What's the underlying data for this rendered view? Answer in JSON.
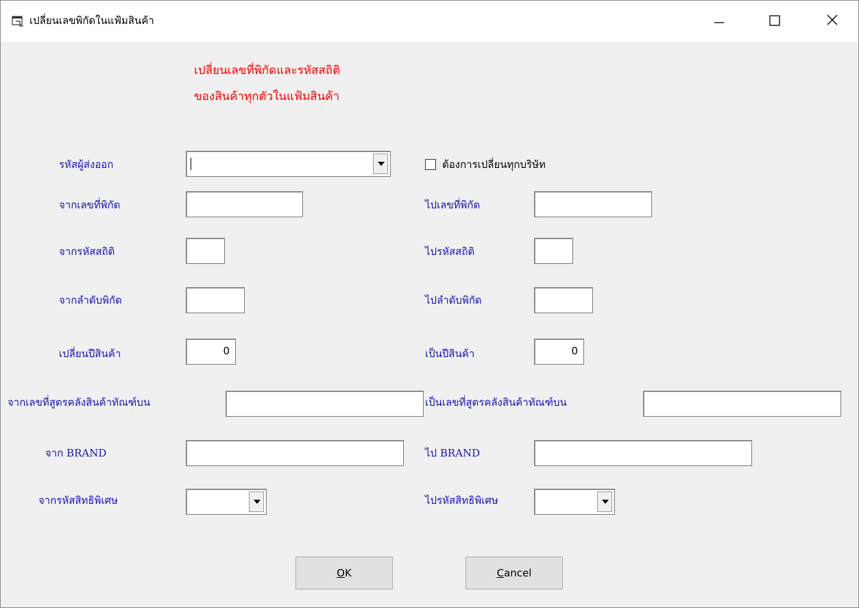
{
  "window": {
    "title": "เปลี่ยนเลขพิกัดในแฟ้มสินค้า",
    "minimize": "—",
    "maximize": "☐",
    "close": "✕"
  },
  "heading": {
    "line1": "เปลี่ยนเลขที่พิกัดและรหัสสถิติ",
    "line2": "ของสินค้าทุกตัวในแฟ้มสินค้า"
  },
  "form": {
    "exporter_code": {
      "label": "รหัสผู้ส่งออก",
      "value": ""
    },
    "all_companies": {
      "label": "ต้องการเปลี่ยนทุกบริษัท",
      "checked": false
    },
    "from_tariff_no": {
      "label": "จากเลขที่พิกัด",
      "value": ""
    },
    "to_tariff_no": {
      "label": "ไปเลขที่พิกัด",
      "value": ""
    },
    "from_stat_code": {
      "label": "จากรหัสสถิติ",
      "value": ""
    },
    "to_stat_code": {
      "label": "ไปรหัสสถิติ",
      "value": ""
    },
    "from_tariff_seq": {
      "label": "จากลำดับพิกัด",
      "value": ""
    },
    "to_tariff_seq": {
      "label": "ไปลำดับพิกัด",
      "value": ""
    },
    "change_product_year": {
      "label": "เปลี่ยนปีสินค้า",
      "value": "0"
    },
    "to_product_year": {
      "label": "เป็นปีสินค้า",
      "value": "0"
    },
    "from_bonded_formula": {
      "label": "จากเลขที่สูตรคลังสินค้าทัณฑ์บน",
      "value": ""
    },
    "to_bonded_formula": {
      "label": "เป็นเลขที่สูตรคลังสินค้าทัณฑ์บน",
      "value": ""
    },
    "from_brand": {
      "label": "จาก BRAND",
      "value": ""
    },
    "to_brand": {
      "label": "ไป BRAND",
      "value": ""
    },
    "from_privilege_code": {
      "label": "จากรหัสสิทธิพิเศษ",
      "value": ""
    },
    "to_privilege_code": {
      "label": "ไปรหัสสิทธิพิเศษ",
      "value": ""
    }
  },
  "buttons": {
    "ok": {
      "accel": "O",
      "rest": "K"
    },
    "cancel": {
      "accel": "C",
      "rest": "ancel"
    }
  },
  "icons": {
    "app": "window-app-icon",
    "dropdown": "chevron-down-icon",
    "checkbox": "checkbox-icon"
  }
}
